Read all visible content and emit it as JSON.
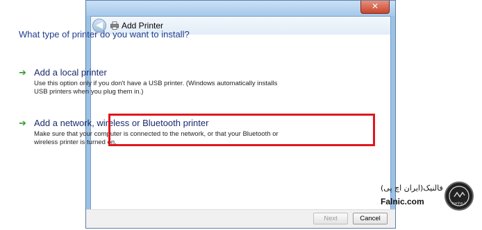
{
  "window": {
    "title": "Add Printer",
    "close_glyph": "✕"
  },
  "nav": {
    "back_glyph": "◀"
  },
  "question": "What type of printer do you want to install?",
  "options": [
    {
      "title": "Add a local printer",
      "description": "Use this option only if you don't have a USB printer. (Windows automatically installs USB printers when you plug them in.)",
      "icon": "green-arrow-icon"
    },
    {
      "title": "Add a network, wireless or Bluetooth printer",
      "description": "Make sure that your computer is connected to the network, or that your Bluetooth or wireless printer is turned on.",
      "icon": "green-arrow-icon"
    }
  ],
  "footer": {
    "next_label": "Next",
    "cancel_label": "Cancel"
  },
  "watermark": {
    "text_fa": "فالنیک(ایران اچ پی)",
    "text_en": "Falnic.com",
    "badge_text": "iranhp.ir"
  },
  "colors": {
    "highlight": "#e0161c",
    "arrow": "#2f9a2a",
    "question_text": "#1f3d8c"
  }
}
